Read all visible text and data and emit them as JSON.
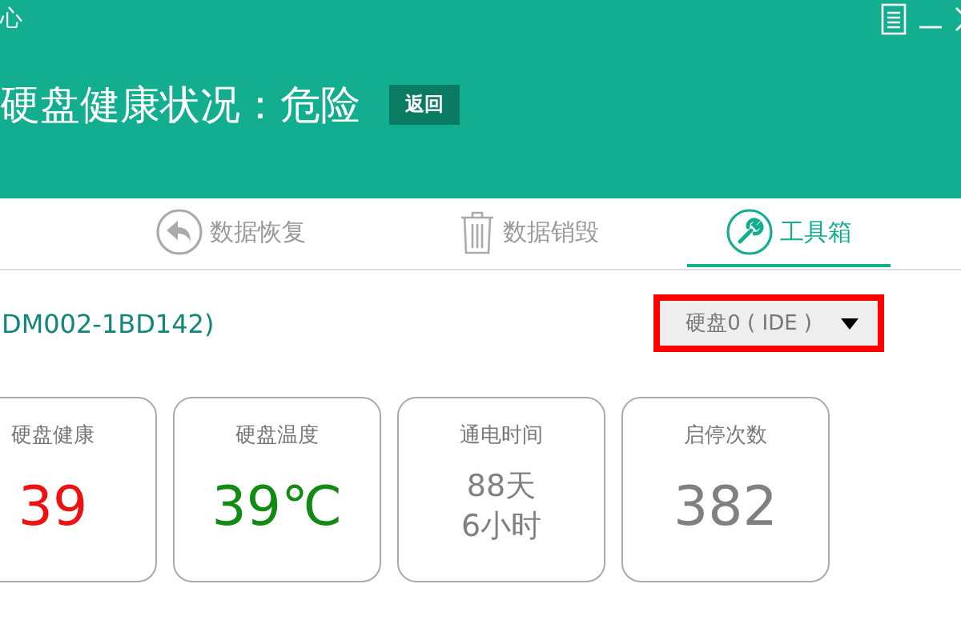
{
  "window": {
    "title": "心"
  },
  "header": {
    "title": "硬盘健康状况：危险",
    "back_button": "返回"
  },
  "tabs": [
    {
      "label": "数据恢复",
      "selected": false
    },
    {
      "label": "数据销毁",
      "selected": false
    },
    {
      "label": "工具箱",
      "selected": true
    }
  ],
  "disk_model": "DM002-1BD142)",
  "disk_select": {
    "value": "硬盘0 ( IDE )",
    "highlighted": true
  },
  "cards": [
    {
      "label": "硬盘健康",
      "lines": [
        "39"
      ],
      "color": "#ee1111"
    },
    {
      "label": "硬盘温度",
      "lines": [
        "39℃"
      ],
      "color": "#138a13"
    },
    {
      "label": "通电时间",
      "lines": [
        "88天",
        "6小时"
      ],
      "color": "#808080"
    },
    {
      "label": "启停次数",
      "lines": [
        "382"
      ],
      "color": "#808080"
    }
  ]
}
